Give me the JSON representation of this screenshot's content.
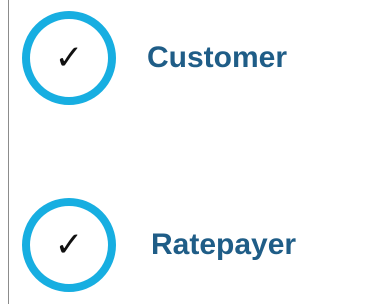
{
  "items": [
    {
      "label": "Customer",
      "icon": "checkmark-icon",
      "icon_glyph": "✓"
    },
    {
      "label": "Ratepayer",
      "icon": "checkmark-icon",
      "icon_glyph": "✓"
    }
  ],
  "colors": {
    "ring": "#17aee1",
    "label": "#1f5d87",
    "check": "#111111",
    "rule": "#8c8c8c"
  }
}
